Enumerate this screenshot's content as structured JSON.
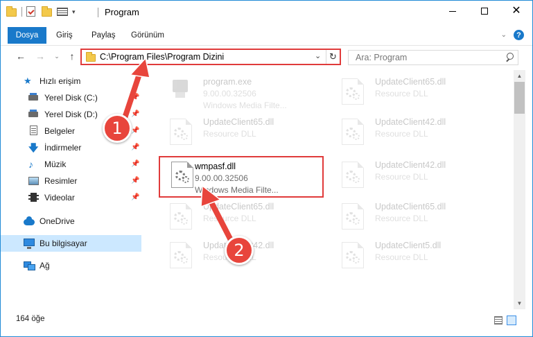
{
  "window": {
    "title": "Program",
    "controls": {
      "minimize": "—",
      "maximize": "□",
      "close": "✕"
    }
  },
  "ribbon": {
    "tabs": [
      "Dosya",
      "Giriş",
      "Paylaş",
      "Görünüm"
    ]
  },
  "navigation": {
    "address": "C:\\Program Files\\Program Dizini",
    "search_placeholder": "Ara: Program"
  },
  "sidebar": {
    "items": [
      {
        "label": "Hızlı erişim",
        "icon": "star-icon"
      },
      {
        "label": "Yerel Disk (C:)",
        "icon": "disk-icon",
        "pinned": true
      },
      {
        "label": "Yerel Disk (D:)",
        "icon": "disk-icon",
        "pinned": true
      },
      {
        "label": "Belgeler",
        "icon": "documents-icon",
        "pinned": true
      },
      {
        "label": "İndirmeler",
        "icon": "downloads-icon",
        "pinned": true
      },
      {
        "label": "Müzik",
        "icon": "music-icon",
        "pinned": true
      },
      {
        "label": "Resimler",
        "icon": "pictures-icon",
        "pinned": true
      },
      {
        "label": "Videolar",
        "icon": "videos-icon",
        "pinned": true
      },
      {
        "label": "OneDrive",
        "icon": "onedrive-icon"
      },
      {
        "label": "Bu bilgisayar",
        "icon": "computer-icon",
        "selected": true
      },
      {
        "label": "Ağ",
        "icon": "network-icon"
      }
    ]
  },
  "files": [
    {
      "name": "program.exe",
      "line2": "9.00.00.32506",
      "line3": "Windows Media Filte...",
      "faded": true
    },
    {
      "name": "UpdateClient65.dll",
      "line2": "Resource DLL",
      "faded": true
    },
    {
      "name": "UpdateClient65.dll",
      "line2": "Resource DLL",
      "faded": true
    },
    {
      "name": "UpdateClient42.dll",
      "line2": "Resource DLL",
      "faded": true
    },
    {
      "name": "wmpasf.dll",
      "line2": "9.00.00.32506",
      "line3": "Windows Media Filte...",
      "highlight": true
    },
    {
      "name": "UpdateClient42.dll",
      "line2": "Resource DLL",
      "faded": true
    },
    {
      "name": "UpdateClient65.dll",
      "line2": "Resource DLL",
      "faded": true
    },
    {
      "name": "UpdateClient65.dll",
      "line2": "Resource DLL",
      "faded": true
    },
    {
      "name": "UpdateClient42.dll",
      "line2": "Resource DLL",
      "faded": true
    },
    {
      "name": "UpdateClient5.dll",
      "line2": "Resource DLL",
      "faded": true
    }
  ],
  "status": {
    "item_count": "164 öğe"
  },
  "annotations": {
    "step1": "1",
    "step2": "2",
    "color": "#e8453c"
  },
  "colors": {
    "accent": "#1979ca",
    "highlight_border": "#e03a3a",
    "selected_bg": "#cce8ff"
  }
}
